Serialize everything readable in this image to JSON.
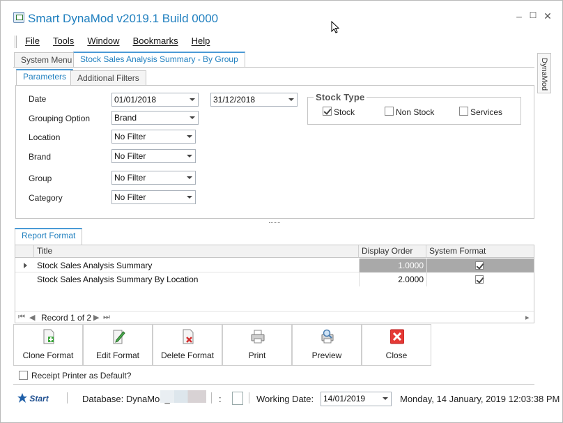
{
  "window": {
    "title": "Smart DynaMod v2019.1 Build 0000",
    "minimize": "–",
    "maximize": "☐",
    "close": "✕"
  },
  "menu": [
    "File",
    "Tools",
    "Window",
    "Bookmarks",
    "Help"
  ],
  "side_tab": "DynaMod",
  "doc_tabs": [
    "System Menu",
    "Stock Sales Analysis Summary - By Group"
  ],
  "param_tabs": [
    "Parameters",
    "Additional Filters"
  ],
  "params": {
    "date_label": "Date",
    "date_from": "01/01/2018",
    "date_to": "31/12/2018",
    "grouping_label": "Grouping Option",
    "grouping_value": "Brand",
    "location_label": "Location",
    "location_value": "No Filter",
    "brand_label": "Brand",
    "brand_value": "No Filter",
    "group_label": "Group",
    "group_value": "No Filter",
    "category_label": "Category",
    "category_value": "No Filter"
  },
  "stock_type": {
    "title": "Stock Type",
    "options": [
      {
        "label": "Stock",
        "checked": true
      },
      {
        "label": "Non Stock",
        "checked": false
      },
      {
        "label": "Services",
        "checked": false
      }
    ]
  },
  "report_tab": "Report Format",
  "grid": {
    "columns": [
      "Title",
      "Display Order",
      "System Format"
    ],
    "rows": [
      {
        "title": "Stock Sales Analysis Summary",
        "order": "1.0000",
        "system": true
      },
      {
        "title": "Stock Sales Analysis Summary By Location",
        "order": "2.0000",
        "system": true
      }
    ],
    "record_text": "Record 1 of 2"
  },
  "buttons": [
    "Clone Format",
    "Edit Format",
    "Delete Format",
    "Print",
    "Preview",
    "Close"
  ],
  "receipt_printer": {
    "label": "Receipt Printer as Default?",
    "checked": false
  },
  "status": {
    "logo": "Start",
    "database": "Database: DynaMod_",
    "colon": ":",
    "working_date_label": "Working Date:",
    "working_date": "14/01/2019",
    "datetime": "Monday, 14 January, 2019 12:03:38 PM"
  }
}
